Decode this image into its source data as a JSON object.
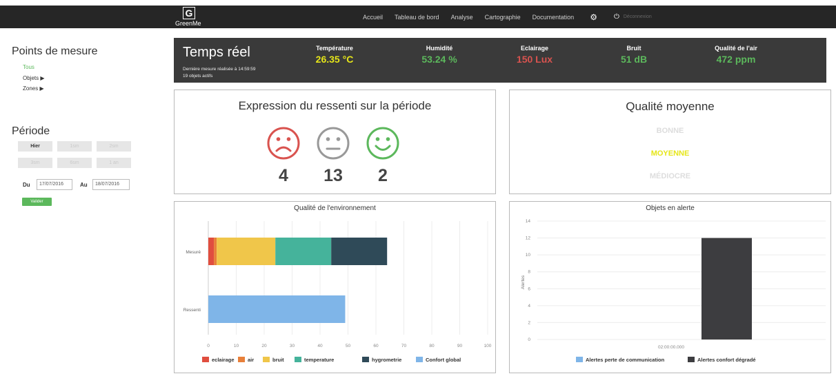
{
  "brand": {
    "letter": "G",
    "name": "GreenMe"
  },
  "nav": {
    "items": [
      "Accueil",
      "Tableau de bord",
      "Analyse",
      "Cartographie",
      "Documentation"
    ],
    "user": "Déconnexion"
  },
  "sidebar": {
    "points_title": "Points de mesure",
    "tous": "Tous",
    "objets": "Objets",
    "zones": "Zones",
    "periode_title": "Période",
    "period_buttons": [
      "Hier",
      "1sm",
      "2sm",
      "3sm",
      "6sm",
      "1 an"
    ],
    "du_label": "Du",
    "du_value": "17/07/2016",
    "au_label": "Au",
    "au_value": "18/07/2016",
    "valider": "Valider"
  },
  "realtime": {
    "title": "Temps réel",
    "last_measure": "Dernière mesure réalisée à 14:59:59",
    "active_objects": "19 objets actifs",
    "metrics": [
      {
        "label": "Température",
        "value": "26.35 °C",
        "color": "#e6e619"
      },
      {
        "label": "Humidité",
        "value": "53.24 %",
        "color": "#5cb85c"
      },
      {
        "label": "Eclairage",
        "value": "150 Lux",
        "color": "#d9534f"
      },
      {
        "label": "Bruit",
        "value": "51 dB",
        "color": "#5cb85c"
      },
      {
        "label": "Qualité de l'air",
        "value": "472 ppm",
        "color": "#5cb85c"
      }
    ]
  },
  "ressenti": {
    "title": "Expression du ressenti sur la période",
    "counts": [
      "4",
      "13",
      "2"
    ],
    "colors": [
      "#d9534f",
      "#999999",
      "#5cb85c"
    ]
  },
  "qualite": {
    "title": "Qualité moyenne",
    "levels": [
      "BONNE",
      "MOYENNE",
      "MÉDIOCRE"
    ],
    "active_color": "#e6e619",
    "inactive_color": "#dddddd"
  },
  "chart_data": [
    {
      "type": "bar",
      "orientation": "horizontal",
      "stacked": true,
      "title": "Qualité de l'environnement",
      "categories": [
        "Mesuré",
        "Ressenti"
      ],
      "xlim": [
        0,
        100
      ],
      "xticks": [
        "0",
        "10",
        "20",
        "30",
        "40",
        "50",
        "60",
        "70",
        "80",
        "90",
        "100"
      ],
      "series": [
        {
          "name": "eclairage",
          "color": "#e04e3f",
          "values": [
            2,
            0
          ]
        },
        {
          "name": "air",
          "color": "#e8803a",
          "values": [
            1,
            0
          ]
        },
        {
          "name": "bruit",
          "color": "#f0c64a",
          "values": [
            21,
            0
          ]
        },
        {
          "name": "temperature",
          "color": "#45b39b",
          "values": [
            20,
            0
          ]
        },
        {
          "name": "hygrometrie",
          "color": "#2f4a58",
          "values": [
            20,
            0
          ]
        },
        {
          "name": "Confort global",
          "color": "#7fb5e8",
          "values": [
            0,
            49
          ]
        }
      ],
      "grid": true,
      "legend": "bottom"
    },
    {
      "type": "bar",
      "title": "Objets en alerte",
      "ylabel": "Alertes",
      "categories": [
        "02:00:00.000"
      ],
      "ylim": [
        0,
        14
      ],
      "yticks": [
        "0",
        "2",
        "4",
        "6",
        "8",
        "10",
        "12",
        "14"
      ],
      "series": [
        {
          "name": "Alertes perte de communication",
          "color": "#7fb5e8",
          "values": [
            0
          ]
        },
        {
          "name": "Alertes confort dégradé",
          "color": "#3d3d40",
          "values": [
            12
          ]
        }
      ],
      "grid": true,
      "legend": "bottom"
    }
  ]
}
